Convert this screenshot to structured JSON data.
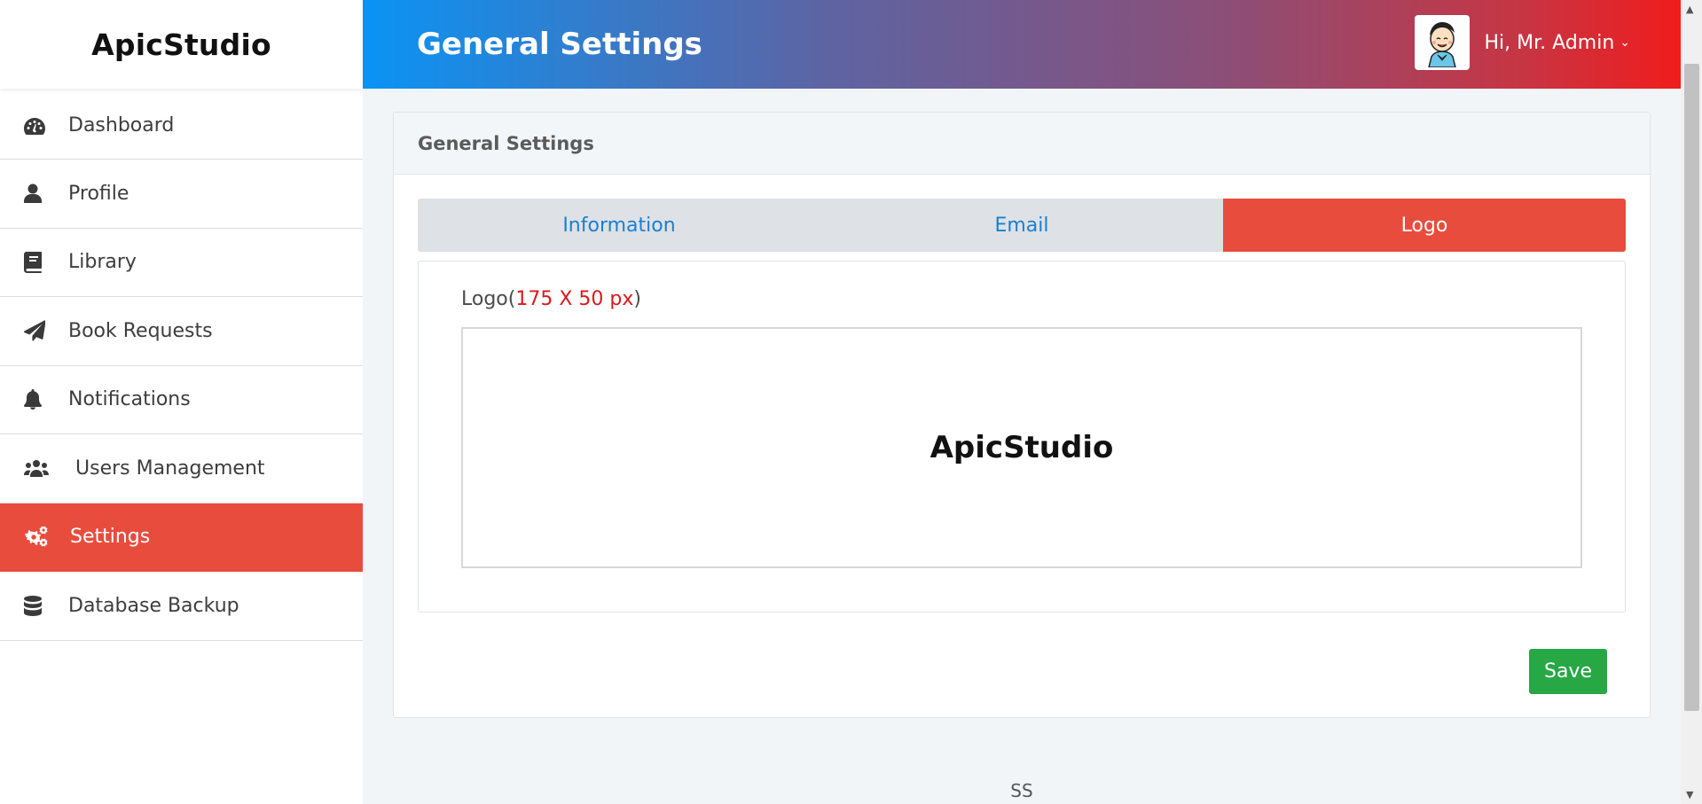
{
  "brand": {
    "name": "ApicStudio"
  },
  "sidebar": {
    "items": [
      {
        "label": "Dashboard",
        "icon": "tachometer-icon"
      },
      {
        "label": "Profile",
        "icon": "user-icon"
      },
      {
        "label": "Library",
        "icon": "book-icon"
      },
      {
        "label": "Book Requests",
        "icon": "paper-plane-icon"
      },
      {
        "label": "Notifications",
        "icon": "bell-icon"
      },
      {
        "label": "Users Management",
        "icon": "users-icon"
      },
      {
        "label": "Settings",
        "icon": "cogs-icon",
        "active": true
      },
      {
        "label": "Database Backup",
        "icon": "database-icon"
      }
    ]
  },
  "header": {
    "title": "General Settings",
    "user_greeting": "Hi, Mr. Admin",
    "chevron": "⌄"
  },
  "card": {
    "title": "General Settings",
    "tabs": [
      {
        "label": "Information"
      },
      {
        "label": "Email"
      },
      {
        "label": "Logo",
        "active": true
      }
    ],
    "logo": {
      "label": "Logo",
      "open_paren": "(",
      "size": "175 X 50 px",
      "close_paren": ")",
      "preview_text": "ApicStudio"
    },
    "save_label": "Save"
  },
  "footer": {
    "text": "SS"
  },
  "colors": {
    "accent": "#e84c3d",
    "save": "#28a745",
    "tab_text": "#1a7fd4",
    "size_note": "#d9191c",
    "header_gradient_start": "#0a94f4",
    "header_gradient_end": "#f11c1c"
  }
}
